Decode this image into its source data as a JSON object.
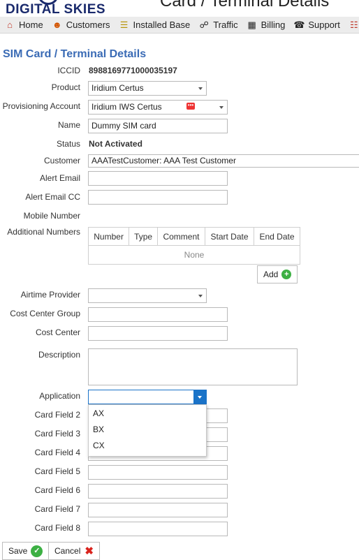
{
  "brand": {
    "logo_text": "DIGITAL SKIES",
    "page_heading": "Card / Terminal Details"
  },
  "nav": {
    "items": [
      {
        "label": "Home",
        "icon": "home-icon"
      },
      {
        "label": "Customers",
        "icon": "customers-icon"
      },
      {
        "label": "Installed Base",
        "icon": "installed-base-icon"
      },
      {
        "label": "Traffic",
        "icon": "traffic-icon"
      },
      {
        "label": "Billing",
        "icon": "billing-icon"
      },
      {
        "label": "Support",
        "icon": "support-icon"
      }
    ]
  },
  "form": {
    "title": "SIM Card / Terminal Details",
    "iccid": {
      "label": "ICCID",
      "value": "8988169771000035197"
    },
    "product": {
      "label": "Product",
      "value": "Iridium Certus"
    },
    "provisioning": {
      "label": "Provisioning Account",
      "value": "Iridium IWS Certus"
    },
    "name": {
      "label": "Name",
      "value": "Dummy SIM card"
    },
    "status": {
      "label": "Status",
      "value": "Not Activated"
    },
    "customer": {
      "label": "Customer",
      "value": "AAATestCustomer: AAA Test Customer"
    },
    "alert_email": {
      "label": "Alert Email",
      "value": ""
    },
    "alert_email_cc": {
      "label": "Alert Email CC",
      "value": ""
    },
    "mobile_number": {
      "label": "Mobile Number"
    },
    "additional_numbers": {
      "label": "Additional Numbers",
      "columns": [
        "Number",
        "Type",
        "Comment",
        "Start Date",
        "End Date"
      ],
      "empty_text": "None",
      "add_label": "Add"
    },
    "airtime_provider": {
      "label": "Airtime Provider",
      "value": ""
    },
    "cost_center_group": {
      "label": "Cost Center Group",
      "value": ""
    },
    "cost_center": {
      "label": "Cost Center",
      "value": ""
    },
    "description": {
      "label": "Description",
      "value": ""
    },
    "application": {
      "label": "Application",
      "value": "",
      "options": [
        "AX",
        "BX",
        "CX"
      ]
    },
    "card_fields": [
      {
        "label": "Card Field 2",
        "value": ""
      },
      {
        "label": "Card Field 3",
        "value": ""
      },
      {
        "label": "Card Field 4",
        "value": ""
      },
      {
        "label": "Card Field 5",
        "value": ""
      },
      {
        "label": "Card Field 6",
        "value": ""
      },
      {
        "label": "Card Field 7",
        "value": ""
      },
      {
        "label": "Card Field 8",
        "value": ""
      }
    ]
  },
  "actions": {
    "save_label": "Save",
    "cancel_label": "Cancel"
  },
  "colors": {
    "title": "#3a6bb5",
    "accent_select": "#1a73c8",
    "add_green": "#3cb043",
    "cancel_red": "#d9231d"
  }
}
